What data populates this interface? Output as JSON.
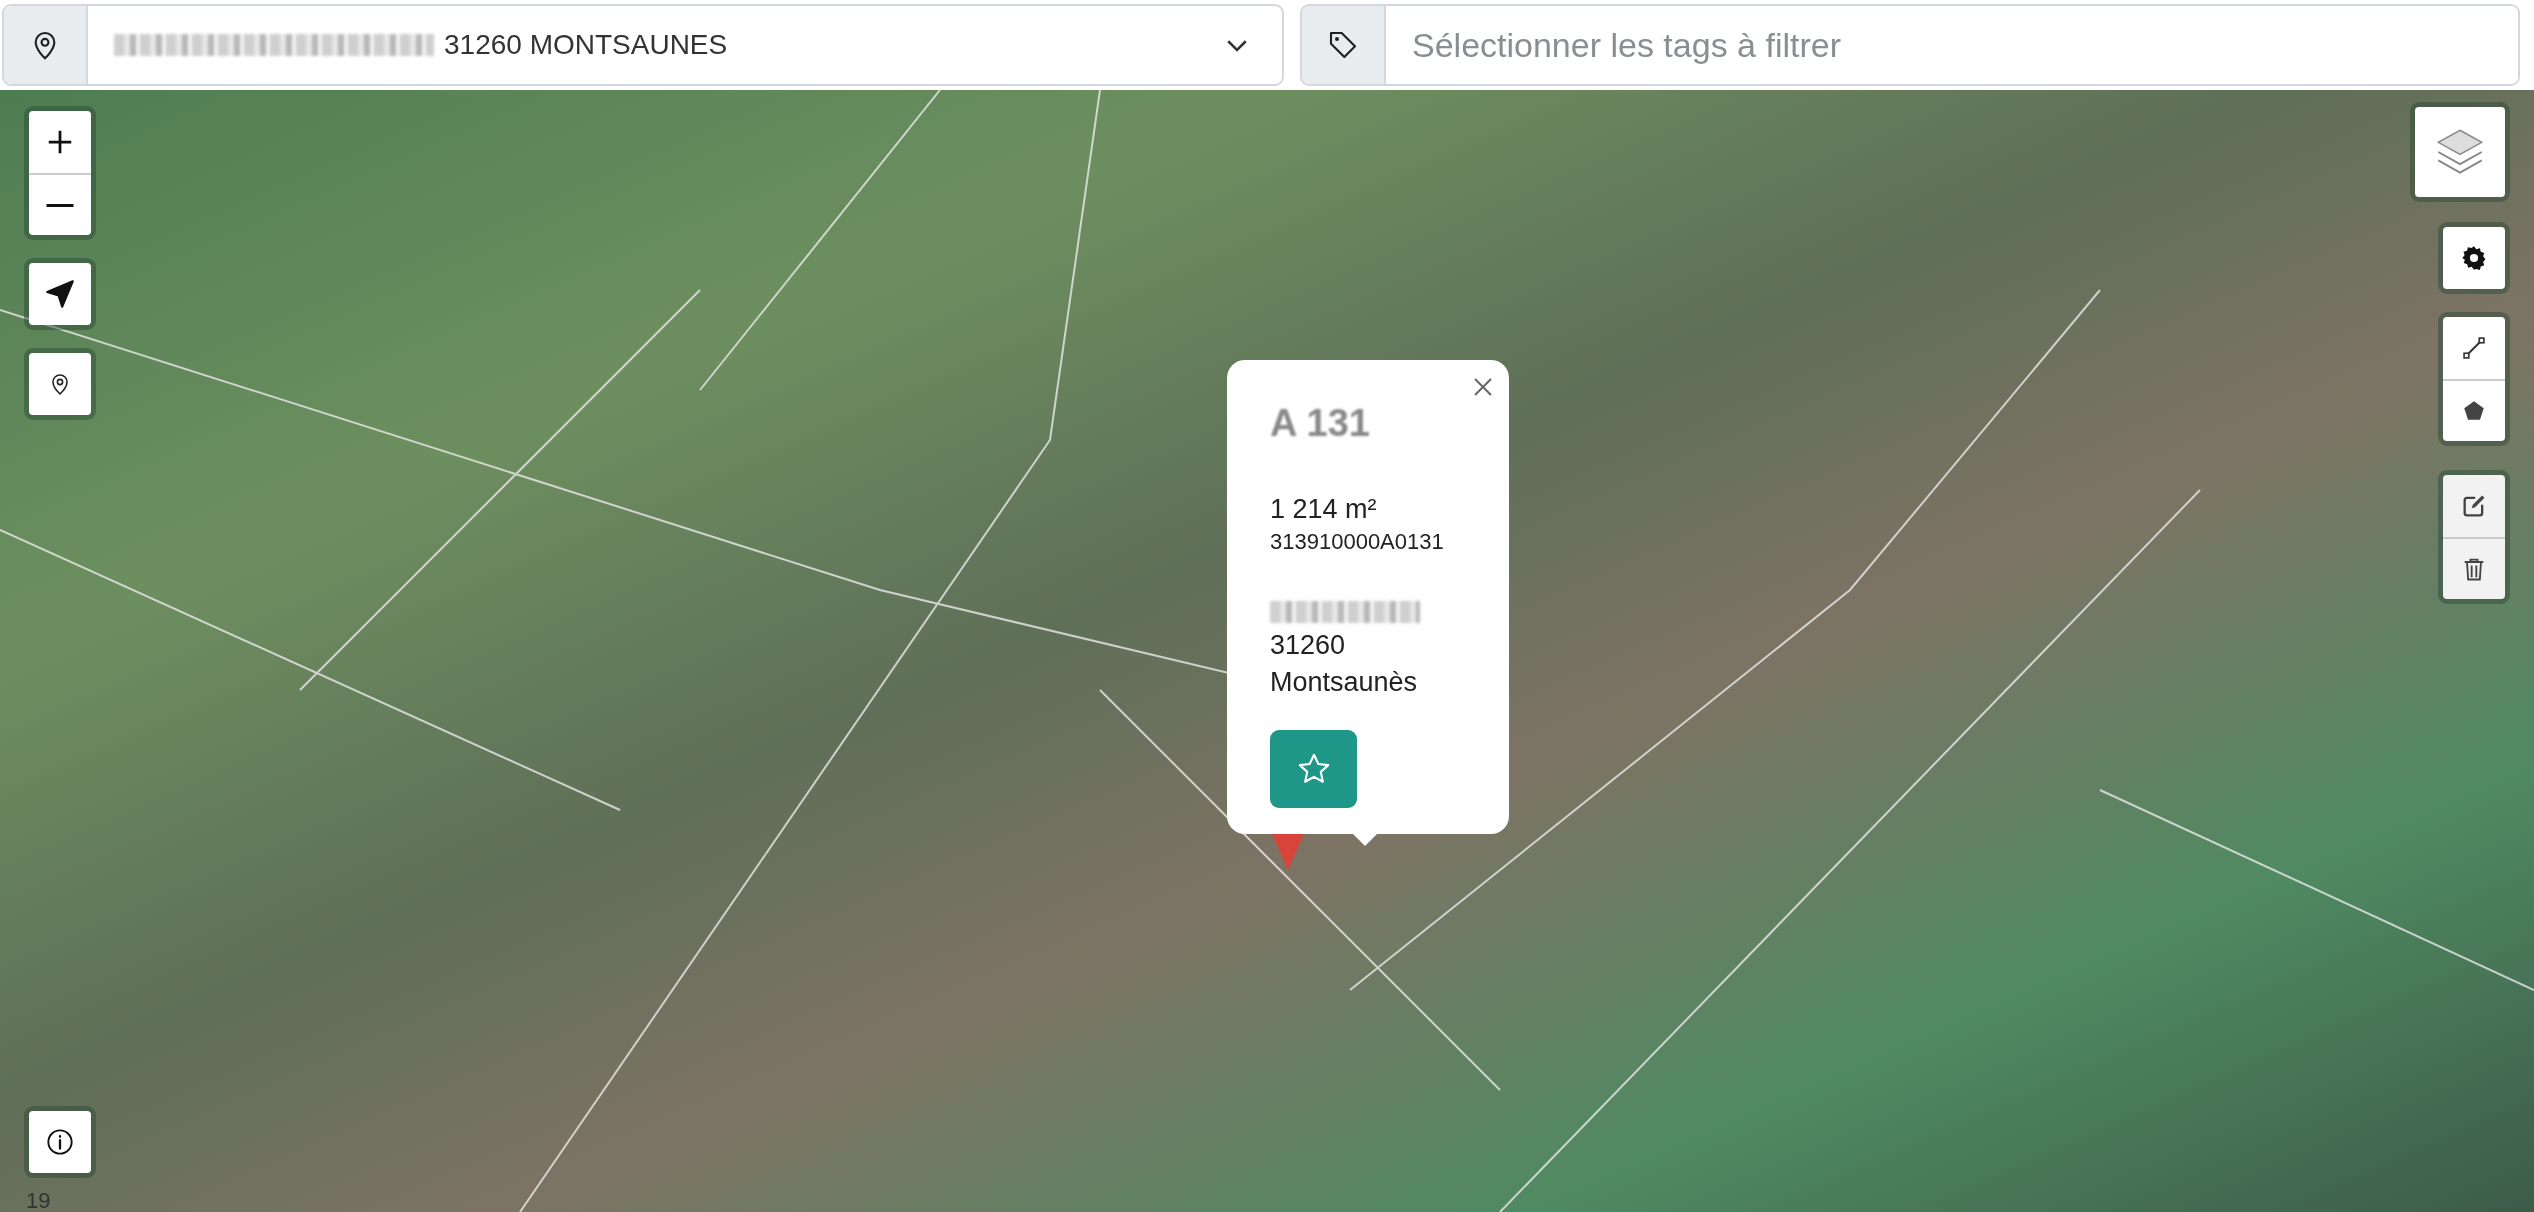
{
  "address_selector": {
    "redacted_prefix": true,
    "value": "31260 MONTSAUNES"
  },
  "tag_filter": {
    "placeholder": "Sélectionner les tags à filtrer"
  },
  "popup": {
    "title": "A 131",
    "area": "1 214 m²",
    "parcel_id": "313910000A0131",
    "address_redacted": true,
    "postcode": "31260",
    "city": "Montsaunès",
    "favorite": false
  },
  "map": {
    "zoom_label": "19"
  }
}
